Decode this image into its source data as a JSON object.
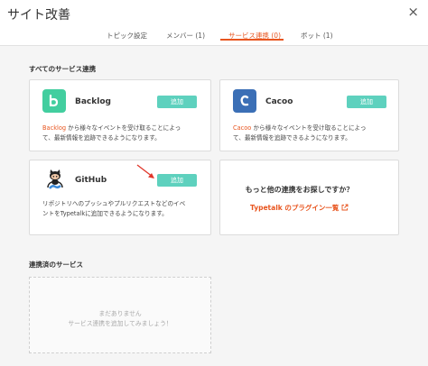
{
  "header": {
    "title": "サイト改善",
    "close_label": "×"
  },
  "tabs": [
    {
      "label": "トピック設定"
    },
    {
      "label": "メンバー (1)"
    },
    {
      "label": "サービス連携 (0)"
    },
    {
      "label": "ボット (1)"
    }
  ],
  "all_services": {
    "title": "すべてのサービス連携",
    "add_label": "追加",
    "services": [
      {
        "name": "Backlog",
        "link": "Backlog",
        "desc_rest_1": " から様々なイベントを受け取ることによっ",
        "desc_rest_2": "て、最新情報を追跡できるようになります。"
      },
      {
        "name": "Cacoo",
        "link": "Cacoo",
        "desc_rest_1": " から様々なイベントを受け取ることによっ",
        "desc_rest_2": "て、最新情報を追跡できるようになります。"
      },
      {
        "name": "GitHub",
        "desc_1": "リポジトリへのプッシュやプルリクエストなどのイベ",
        "desc_2": "ントをTypetalkに追加できるようになります。"
      }
    ],
    "more": {
      "title": "もっと他の連携をお探しですか？",
      "link": "Typetalk のプラグイン一覧"
    }
  },
  "connected": {
    "title": "連携済のサービス",
    "empty_1": "まだありません",
    "empty_2": "サービス連携を追加してみましょう！"
  },
  "colors": {
    "accent": "#e8551f",
    "add_button": "#5ed1be",
    "backlog": "#42ce9f",
    "cacoo": "#3b6fb6"
  },
  "icons": [
    "close-icon",
    "backlog-logo-icon",
    "cacoo-logo-icon",
    "github-octocat-icon",
    "arrow-annotation-icon",
    "external-link-icon"
  ]
}
